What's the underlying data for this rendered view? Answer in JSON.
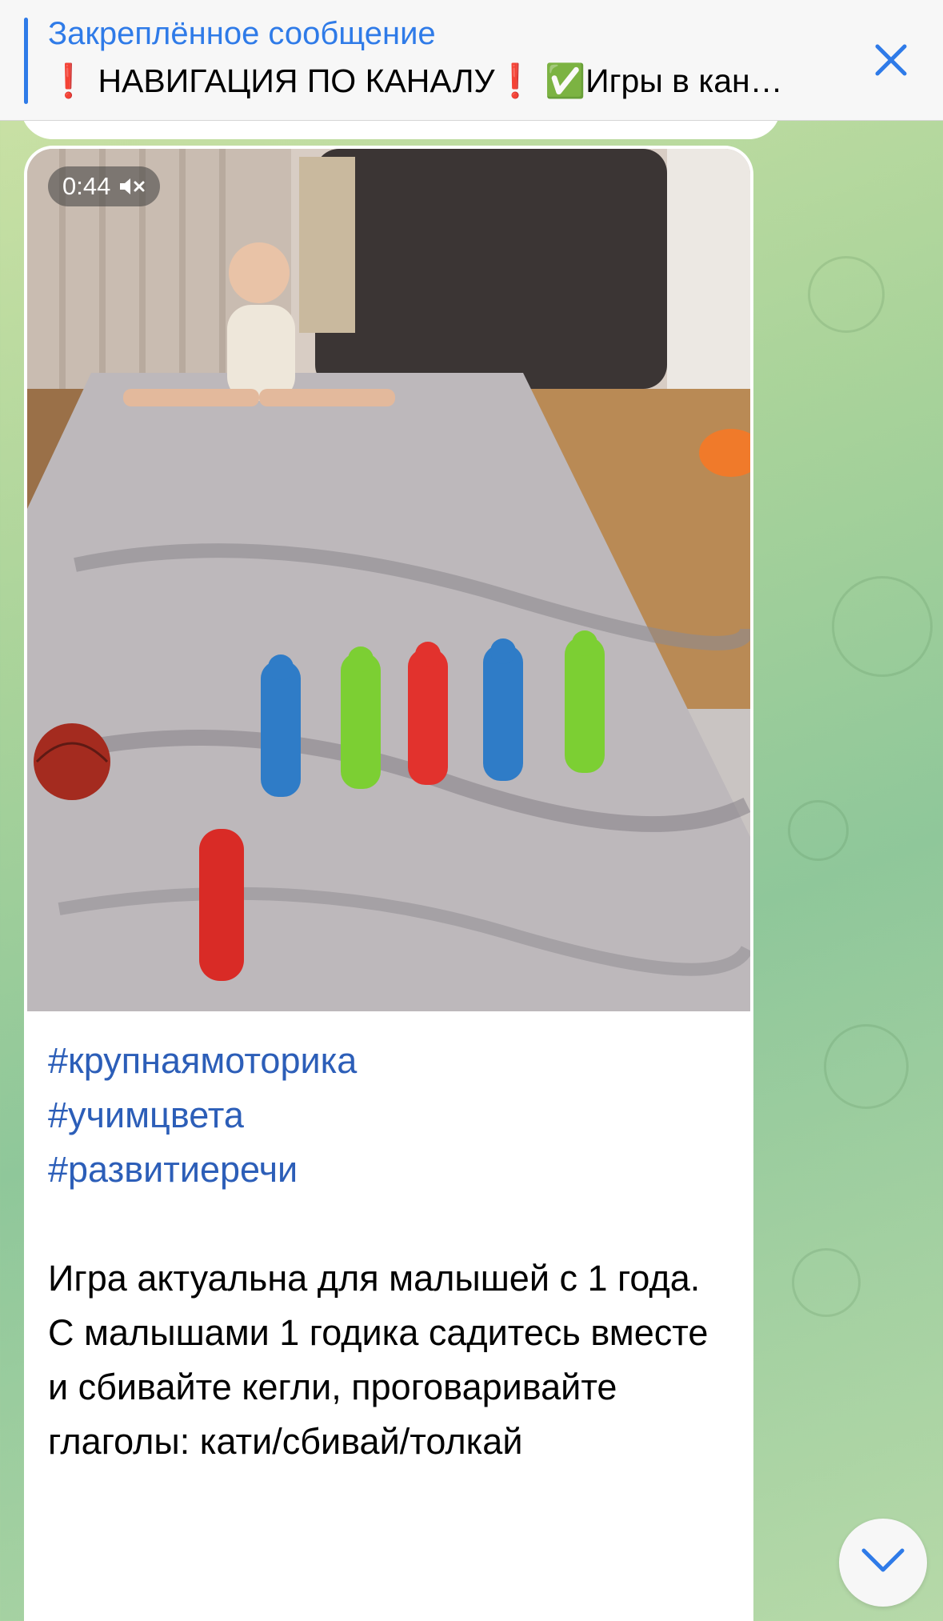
{
  "pinned": {
    "title": "Закреплённое сообщение",
    "text": "❗️ НАВИГАЦИЯ ПО КАНАЛУ❗️ ✅Игры в кан…",
    "close_icon": "close-icon",
    "accent": "#2f7be8"
  },
  "video": {
    "duration": "0:44",
    "muted_icon": "speaker-muted-icon",
    "description": "girl sitting on a rug with bowling pins and a ball"
  },
  "message": {
    "hashtags": [
      "#крупнаямоторика",
      "#учимцвета",
      "#развитиеречи"
    ],
    "paragraph1": "Игра актуальна для малышей с 1 года.",
    "paragraph2": "С малышами 1 годика садитесь вместе и сбивайте кегли, проговаривайте глаголы: кати/сбивай/толкай",
    "hashtag_color": "#2c5eb8"
  },
  "controls": {
    "scroll_down_icon": "chevron-down-icon"
  }
}
